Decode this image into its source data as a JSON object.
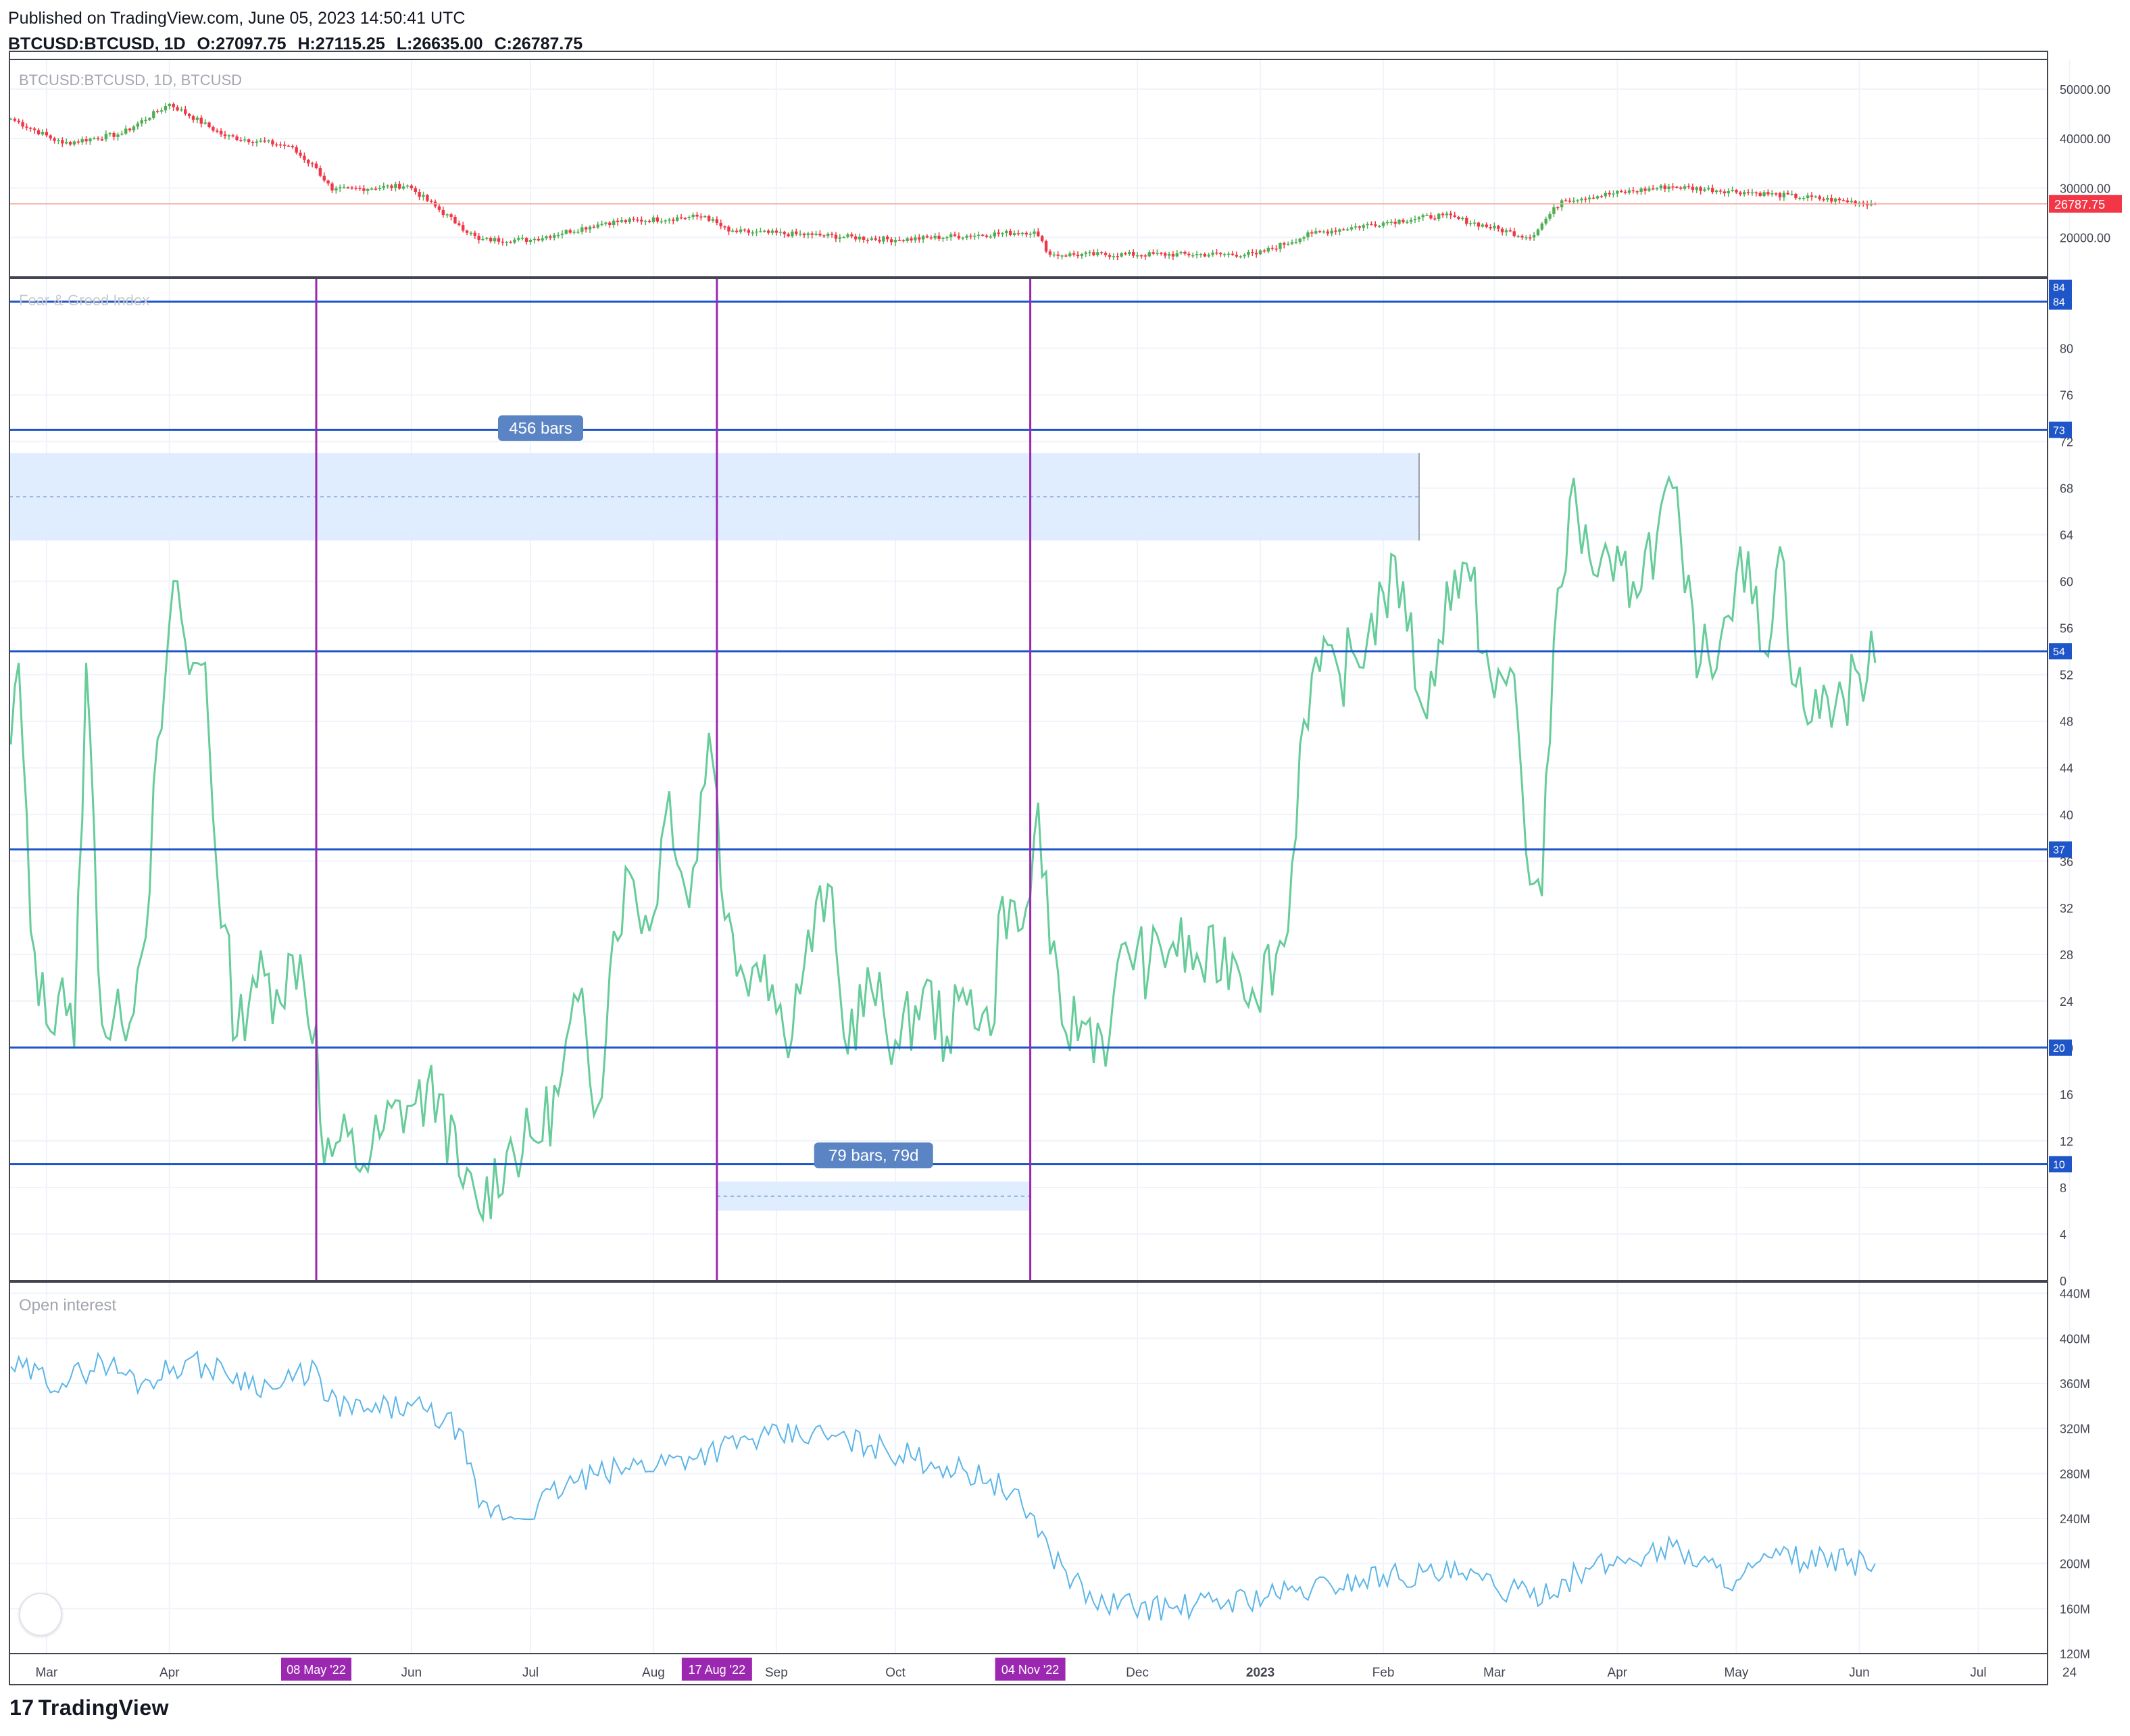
{
  "header": {
    "published": "Published on TradingView.com, June 05, 2023 14:50:41 UTC",
    "symbol": "BTCUSD:BTCUSD, 1D",
    "open": "O:27097.75",
    "high": "H:27115.25",
    "low": "L:26635.00",
    "close": "C:26787.75"
  },
  "footer": {
    "brand": "TradingView",
    "brand_mark": "17"
  },
  "colors": {
    "up": "#4caf50",
    "down": "#f23645",
    "fng_line": "#66cc99",
    "oi_line": "#5bb5e8",
    "hline": "#1e55c8",
    "vline": "#9c27b0",
    "range_fill": "#dbeafe",
    "price_tag": "#f23645",
    "bg": "#ffffff"
  },
  "chart_data": [
    {
      "type": "candlestick",
      "title": "BTCUSD:BTCUSD, 1D, BTCUSD",
      "ylim": [
        12000,
        56000
      ],
      "y_ticks": [
        20000,
        30000,
        40000,
        50000
      ],
      "y_tick_labels": [
        "20000.00",
        "30000.00",
        "40000.00",
        "50000.00"
      ],
      "last_price_label": "26787.75",
      "last_price": 26787.75,
      "x_range": [
        "2022-02-20",
        "2023-06-05"
      ],
      "approx_close_anchors": [
        [
          "2022-02-20",
          44000
        ],
        [
          "2022-03-05",
          39000
        ],
        [
          "2022-03-20",
          41000
        ],
        [
          "2022-04-01",
          47000
        ],
        [
          "2022-04-15",
          40500
        ],
        [
          "2022-05-01",
          38500
        ],
        [
          "2022-05-08",
          34000
        ],
        [
          "2022-05-12",
          29500
        ],
        [
          "2022-05-31",
          30500
        ],
        [
          "2022-06-13",
          22500
        ],
        [
          "2022-06-18",
          19500
        ],
        [
          "2022-07-01",
          19500
        ],
        [
          "2022-07-20",
          23000
        ],
        [
          "2022-08-14",
          24300
        ],
        [
          "2022-08-20",
          21200
        ],
        [
          "2022-09-10",
          20500
        ],
        [
          "2022-10-01",
          19500
        ],
        [
          "2022-11-05",
          21200
        ],
        [
          "2022-11-09",
          16500
        ],
        [
          "2022-12-31",
          16600
        ],
        [
          "2023-01-14",
          20800
        ],
        [
          "2023-02-01",
          23000
        ],
        [
          "2023-02-16",
          24500
        ],
        [
          "2023-03-10",
          20000
        ],
        [
          "2023-03-18",
          27500
        ],
        [
          "2023-04-14",
          30300
        ],
        [
          "2023-05-06",
          29000
        ],
        [
          "2023-06-05",
          26787
        ]
      ]
    },
    {
      "type": "line",
      "title": "Fear & Greed Index",
      "ylim": [
        0,
        86
      ],
      "y_ticks": [
        0,
        4,
        8,
        12,
        16,
        20,
        24,
        28,
        32,
        36,
        40,
        44,
        48,
        52,
        56,
        60,
        64,
        68,
        72,
        76,
        80
      ],
      "horizontal_levels": [
        84,
        73,
        54,
        37,
        20,
        10
      ],
      "level_labels": [
        "84",
        "73",
        "54",
        "37",
        "20",
        "10"
      ],
      "top_badge": "84",
      "series": [
        {
          "values_anchors": [
            [
              "2022-02-20",
              46
            ],
            [
              "2022-02-22",
              53
            ],
            [
              "2022-02-25",
              30
            ],
            [
              "2022-03-01",
              22
            ],
            [
              "2022-03-05",
              26
            ],
            [
              "2022-03-08",
              20
            ],
            [
              "2022-03-11",
              53
            ],
            [
              "2022-03-15",
              22
            ],
            [
              "2022-03-20",
              22
            ],
            [
              "2022-03-25",
              28
            ],
            [
              "2022-03-31",
              52
            ],
            [
              "2022-04-03",
              60
            ],
            [
              "2022-04-06",
              52
            ],
            [
              "2022-04-10",
              53
            ],
            [
              "2022-04-13",
              35
            ],
            [
              "2022-04-18",
              21
            ],
            [
              "2022-04-22",
              26
            ],
            [
              "2022-04-28",
              25
            ],
            [
              "2022-05-04",
              28
            ],
            [
              "2022-05-06",
              22
            ],
            [
              "2022-05-08",
              22
            ],
            [
              "2022-05-10",
              10
            ],
            [
              "2022-05-14",
              12
            ],
            [
              "2022-05-20",
              10
            ],
            [
              "2022-05-25",
              13
            ],
            [
              "2022-05-31",
              15
            ],
            [
              "2022-06-08",
              16
            ],
            [
              "2022-06-13",
              9
            ],
            [
              "2022-06-18",
              6
            ],
            [
              "2022-06-25",
              11
            ],
            [
              "2022-07-02",
              12
            ],
            [
              "2022-07-08",
              16
            ],
            [
              "2022-07-13",
              24
            ],
            [
              "2022-07-18",
              15
            ],
            [
              "2022-07-22",
              30
            ],
            [
              "2022-07-26",
              35
            ],
            [
              "2022-07-31",
              30
            ],
            [
              "2022-08-05",
              42
            ],
            [
              "2022-08-10",
              32
            ],
            [
              "2022-08-15",
              47
            ],
            [
              "2022-08-17",
              42
            ],
            [
              "2022-08-19",
              31
            ],
            [
              "2022-08-23",
              27
            ],
            [
              "2022-08-29",
              28
            ],
            [
              "2022-09-03",
              21
            ],
            [
              "2022-09-08",
              27
            ],
            [
              "2022-09-14",
              34
            ],
            [
              "2022-09-18",
              21
            ],
            [
              "2022-09-25",
              25
            ],
            [
              "2022-10-02",
              20
            ],
            [
              "2022-10-08",
              25
            ],
            [
              "2022-10-14",
              21
            ],
            [
              "2022-10-20",
              25
            ],
            [
              "2022-10-25",
              21
            ],
            [
              "2022-10-28",
              33
            ],
            [
              "2022-11-01",
              30
            ],
            [
              "2022-11-04",
              33
            ],
            [
              "2022-11-06",
              41
            ],
            [
              "2022-11-09",
              28
            ],
            [
              "2022-11-12",
              22
            ],
            [
              "2022-11-18",
              22
            ],
            [
              "2022-11-24",
              21
            ],
            [
              "2022-11-28",
              29
            ],
            [
              "2022-12-04",
              27
            ],
            [
              "2022-12-10",
              29
            ],
            [
              "2022-12-17",
              27
            ],
            [
              "2022-12-25",
              28
            ],
            [
              "2022-12-30",
              25
            ],
            [
              "2023-01-05",
              28
            ],
            [
              "2023-01-08",
              30
            ],
            [
              "2023-01-11",
              46
            ],
            [
              "2023-01-14",
              52
            ],
            [
              "2023-01-21",
              52
            ],
            [
              "2023-01-28",
              55
            ],
            [
              "2023-02-01",
              59
            ],
            [
              "2023-02-06",
              60
            ],
            [
              "2023-02-10",
              50
            ],
            [
              "2023-02-14",
              51
            ],
            [
              "2023-02-17",
              60
            ],
            [
              "2023-02-23",
              60
            ],
            [
              "2023-03-01",
              50
            ],
            [
              "2023-03-06",
              52
            ],
            [
              "2023-03-10",
              34
            ],
            [
              "2023-03-13",
              33
            ],
            [
              "2023-03-16",
              55
            ],
            [
              "2023-03-20",
              67
            ],
            [
              "2023-03-25",
              62
            ],
            [
              "2023-03-31",
              60
            ],
            [
              "2023-04-05",
              60
            ],
            [
              "2023-04-11",
              64
            ],
            [
              "2023-04-15",
              68
            ],
            [
              "2023-04-18",
              59
            ],
            [
              "2023-04-22",
              53
            ],
            [
              "2023-04-27",
              55
            ],
            [
              "2023-05-02",
              63
            ],
            [
              "2023-05-08",
              54
            ],
            [
              "2023-05-12",
              63
            ],
            [
              "2023-05-16",
              51
            ],
            [
              "2023-05-20",
              48
            ],
            [
              "2023-05-24",
              50
            ],
            [
              "2023-05-28",
              50
            ],
            [
              "2023-06-01",
              52
            ],
            [
              "2023-06-05",
              53
            ]
          ]
        }
      ],
      "annotations": [
        {
          "type": "date_range",
          "label": "456 bars",
          "y_top": 71,
          "y_bottom": 63.5
        },
        {
          "type": "date_range",
          "label": "79 bars, 79d",
          "from": "2022-08-17",
          "to": "2022-11-04",
          "y_top": 8.5,
          "y_bottom": 6
        }
      ]
    },
    {
      "type": "line",
      "title": "Open interest",
      "ylim": [
        120,
        450
      ],
      "y_ticks": [
        120,
        160,
        200,
        240,
        280,
        320,
        360,
        400,
        440
      ],
      "y_tick_labels": [
        "120M",
        "160M",
        "200M",
        "240M",
        "280M",
        "320M",
        "360M",
        "400M",
        "440M"
      ],
      "series": [
        {
          "values_anchors": [
            [
              "2022-02-20",
              375
            ],
            [
              "2022-03-05",
              360
            ],
            [
              "2022-03-15",
              380
            ],
            [
              "2022-03-25",
              360
            ],
            [
              "2022-04-05",
              380
            ],
            [
              "2022-04-15",
              370
            ],
            [
              "2022-04-28",
              355
            ],
            [
              "2022-05-08",
              375
            ],
            [
              "2022-05-10",
              345
            ],
            [
              "2022-05-20",
              335
            ],
            [
              "2022-06-01",
              340
            ],
            [
              "2022-06-13",
              320
            ],
            [
              "2022-06-18",
              250
            ],
            [
              "2022-06-28",
              240
            ],
            [
              "2022-07-10",
              270
            ],
            [
              "2022-07-25",
              285
            ],
            [
              "2022-08-10",
              295
            ],
            [
              "2022-08-25",
              310
            ],
            [
              "2022-09-10",
              315
            ],
            [
              "2022-09-25",
              305
            ],
            [
              "2022-10-10",
              290
            ],
            [
              "2022-10-25",
              275
            ],
            [
              "2022-11-04",
              245
            ],
            [
              "2022-11-09",
              210
            ],
            [
              "2022-11-20",
              165
            ],
            [
              "2022-12-10",
              160
            ],
            [
              "2023-01-10",
              175
            ],
            [
              "2023-02-01",
              190
            ],
            [
              "2023-02-20",
              190
            ],
            [
              "2023-03-10",
              170
            ],
            [
              "2023-03-25",
              195
            ],
            [
              "2023-04-15",
              215
            ],
            [
              "2023-05-01",
              185
            ],
            [
              "2023-05-10",
              205
            ],
            [
              "2023-06-05",
              200
            ]
          ]
        }
      ]
    }
  ],
  "x_axis": {
    "labels": [
      [
        "Mar",
        "2022-03-01"
      ],
      [
        "Apr",
        "2022-04-01"
      ],
      [
        "Jun",
        "2022-06-01"
      ],
      [
        "Jul",
        "2022-07-01"
      ],
      [
        "Aug",
        "2022-08-01"
      ],
      [
        "Sep",
        "2022-09-01"
      ],
      [
        "Oct",
        "2022-10-01"
      ],
      [
        "Dec",
        "2022-12-01"
      ],
      [
        "2023",
        "2023-01-01"
      ],
      [
        "Feb",
        "2023-02-01"
      ],
      [
        "Mar",
        "2023-03-01"
      ],
      [
        "Apr",
        "2023-04-01"
      ],
      [
        "May",
        "2023-05-01"
      ],
      [
        "Jun",
        "2023-06-01"
      ],
      [
        "Jul",
        "2023-07-01"
      ],
      [
        "24",
        "2023-07-24"
      ]
    ],
    "markers": [
      [
        "08 May '22",
        "2022-05-08"
      ],
      [
        "17 Aug '22",
        "2022-08-17"
      ],
      [
        "04 Nov '22",
        "2022-11-04"
      ]
    ]
  }
}
